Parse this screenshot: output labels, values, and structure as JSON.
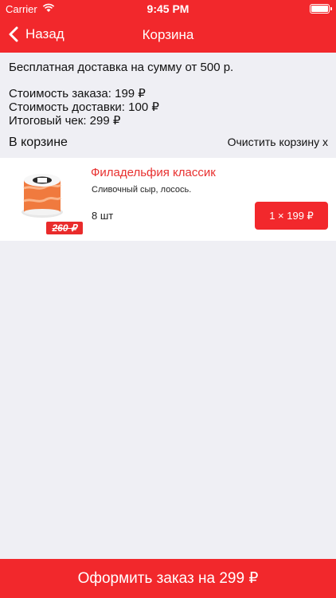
{
  "status_bar": {
    "carrier": "Carrier",
    "time": "9:45 PM"
  },
  "nav": {
    "back_label": "Назад",
    "title": "Корзина"
  },
  "info": {
    "free_delivery": "Бесплатная доставка на сумму от 500 р.",
    "order_cost": "Стоимость заказа: 199 ₽",
    "delivery_cost": "Стоимость доставки: 100 ₽",
    "total": "Итоговый чек: 299 ₽"
  },
  "cart": {
    "title": "В корзине",
    "clear_label": "Очистить корзину x"
  },
  "items": [
    {
      "name": "Филадельфия классик",
      "description": "Сливочный сыр, лосось.",
      "quantity": "8 шт",
      "old_price": "260 ₽",
      "price_button": "1 × 199 ₽"
    }
  ],
  "checkout_label": "Оформить заказ на 299 ₽",
  "colors": {
    "accent": "#f2282c",
    "background": "#efeff4"
  }
}
